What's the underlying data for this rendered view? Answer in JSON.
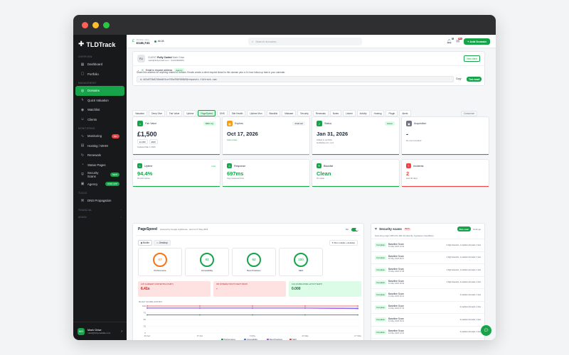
{
  "colors": {
    "accent": "#16a34a",
    "sidebar": "#18191b"
  },
  "sidebar": {
    "brand": "TLDTrack",
    "sections": {
      "overview": "OVERVIEW",
      "management": "MANAGEMENT",
      "monitoring": "MONITORING",
      "tools": "TOOLS",
      "financial": "FINANCIAL",
      "admin": "ADMIN"
    },
    "items": [
      {
        "label": "Dashboard",
        "icon": "grid-icon"
      },
      {
        "label": "Portfolio",
        "icon": "folder-icon"
      },
      {
        "label": "Domains",
        "icon": "globe-icon"
      },
      {
        "label": "Quick Valuation",
        "icon": "bolt-icon"
      },
      {
        "label": "Watchlist",
        "icon": "eye-icon"
      },
      {
        "label": "Clients",
        "icon": "users-icon"
      },
      {
        "label": "Monitoring",
        "icon": "pulse-icon",
        "badge": "99+"
      },
      {
        "label": "Hosting / WHM",
        "icon": "server-icon"
      },
      {
        "label": "Renewals",
        "icon": "refresh-icon"
      },
      {
        "label": "Status Pages",
        "icon": "signal-icon"
      },
      {
        "label": "Security Scans",
        "icon": "shield-icon",
        "badge": "NEW"
      },
      {
        "label": "Agency",
        "icon": "briefcase-icon",
        "badge": "OWN APP"
      },
      {
        "label": "DNS Propagation",
        "icon": "network-icon"
      }
    ],
    "user": {
      "initials": "MG",
      "name": "Mark Grise",
      "email": "mark@fullyundable.com"
    }
  },
  "topbar": {
    "portfolio_label": "Portfolio value",
    "portfolio_value": "£146,741",
    "count_value": "46.08",
    "search_placeholder": "Search domains...",
    "add_button": "+ Add Domain",
    "notif_count": "4",
    "alert_count": "99+"
  },
  "client": {
    "initials": "FU",
    "label": "CLIENT",
    "name": "Fully Coded",
    "owner": "Mark Grise",
    "email": "mark@fullycoded.com",
    "phone": "01234848484",
    "view_client": "View client"
  },
  "email": {
    "title": "Email to request address",
    "tag": "Agency",
    "desc": "Share this address for anything related to domain. Emails create a client request linked to this domain plus a 24-hour follow-up task in your calendar.",
    "address": "d-443c873b6236eb6f4cef55a350f665b9@requests.tldtrack.com",
    "copy": "Copy",
    "test": "Test email"
  },
  "tabs": [
    "Valuation",
    "Deep Dive",
    "Fair Value",
    "Uptime",
    "PageSpeed",
    "DNS",
    "Site Health",
    "Uptime Mon",
    "Blacklist",
    "Malware",
    "Security",
    "Renewals",
    "Notes",
    "Linked",
    "Activity",
    "Hosting",
    "Plugin",
    "Alerts"
  ],
  "tabs_right": "Customize",
  "kpis": [
    {
      "title": "Fair Value",
      "tag": "BRK 1Q",
      "value": "£1,500",
      "sub": "Updated Mar 1 2026",
      "chip1": "£1,000",
      "chip2": "£640",
      "color": "#16a34a",
      "icon": "tag-icon"
    },
    {
      "title": "Expires",
      "tag": "233d left",
      "value": "Oct 17, 2026",
      "sub": "Auto renew",
      "color": "#f59e0b",
      "icon": "calendar-icon"
    },
    {
      "title": "Status",
      "tag": "Active",
      "value": "Jan 31, 2026",
      "sub": "Added to portfolio",
      "sub2": "GoDaddy.com, LLC",
      "color": "#16a34a",
      "icon": "check-icon"
    },
    {
      "title": "Acquisition",
      "tag": "",
      "value": "-",
      "sub": "No cost recorded",
      "color": "#6b7280",
      "icon": "lock-icon"
    }
  ],
  "kpis2": [
    {
      "title": "Uptime",
      "tag": "Live",
      "value": "94.4%",
      "sub": "Re-tick uptime",
      "color": "#16a34a"
    },
    {
      "title": "Response",
      "tag": "",
      "value": "697ms",
      "sub": "Avg measured time",
      "color": "#16a34a"
    },
    {
      "title": "Blacklist",
      "tag": "",
      "value": "Clean",
      "sub": "On clean",
      "color": "#16a34a"
    },
    {
      "title": "Incidents",
      "tag": "",
      "value": "2",
      "sub": "Last 90 days",
      "color": "#ef4444"
    }
  ],
  "pagespeed": {
    "title": "PageSpeed",
    "sub": "powered by Google Lighthouse · last run 17 May 2026",
    "toggle_label": "On",
    "mobile": "Mobile",
    "desktop": "Desktop",
    "run": "Run mobile + desktop",
    "scores": [
      {
        "label": "Performance",
        "value": "67",
        "color": "#f97316"
      },
      {
        "label": "Accessibility",
        "value": "93",
        "color": "#16a34a"
      },
      {
        "label": "Best Practices",
        "value": "92",
        "color": "#16a34a"
      },
      {
        "label": "SEO",
        "value": "100",
        "color": "#16a34a"
      }
    ],
    "metrics": [
      {
        "label": "LCP (LARGEST CONTENTFUL PAINT)",
        "value": "6.41s",
        "color": "#fee2e2",
        "text": "#b91c1c"
      },
      {
        "label": "INP (INTERACTION TO NEXT PAINT)",
        "value": "-",
        "color": "#fee2e2",
        "text": "#b91c1c"
      },
      {
        "label": "CLS (CUMULATIVE LAYOUT SHIFT)",
        "value": "0.000",
        "color": "#dcfce7",
        "text": "#166534"
      }
    ],
    "history_label": "90-DAY SCORE HISTORY"
  },
  "chart_data": {
    "type": "line",
    "x": [
      "20 Apr",
      "27 Apr",
      "4 May",
      "11 May",
      "17 May"
    ],
    "ylim": [
      0,
      100
    ],
    "yticks": [
      0,
      25,
      50,
      75,
      100
    ],
    "series": [
      {
        "name": "Performance",
        "color": "#16a34a",
        "values": [
          67,
          67,
          67,
          67,
          67
        ]
      },
      {
        "name": "Accessibility",
        "color": "#3b82f6",
        "values": [
          93,
          93,
          93,
          93,
          92
        ]
      },
      {
        "name": "Best Practices",
        "color": "#a855f7",
        "values": [
          92,
          92,
          92,
          92,
          90
        ]
      },
      {
        "name": "SEO",
        "color": "#ef4444",
        "values": [
          100,
          100,
          100,
          100,
          100
        ]
      }
    ]
  },
  "security": {
    "title": "Security scans",
    "beta": "BETA",
    "run": "Run scan",
    "settings": "Settings",
    "scanning": "Scanning origin 185.241.184.43 (directly, bypasses cloudflare)",
    "scans": [
      {
        "status": "Complete",
        "name": "Baseline Scan",
        "date": "16 May 2026 13:33",
        "result": "2 high Acunetix, 1 medium Acunetix, 2 low"
      },
      {
        "status": "Complete",
        "name": "Baseline Scan",
        "date": "16 May 2026 08:27",
        "result": "1 high Acunetix, 1 medium Acunetix, 1 low"
      },
      {
        "status": "Complete",
        "name": "Baseline Scan",
        "date": "15 May 2026 07:08",
        "result": "1 high Acunetix, 1 medium Acunetix, 1 low"
      },
      {
        "status": "Complete",
        "name": "Baseline Scan",
        "date": "14 May 2026 18:09",
        "result": "1 high Acunetix, 2 medium Acunetix, 2 low"
      },
      {
        "status": "Complete",
        "name": "Baseline Scan",
        "date": "14 May 2026 09:12",
        "result": "4 medium Acunetix, 1 low"
      },
      {
        "status": "Complete",
        "name": "Baseline Scan",
        "date": "14 May 2026 07:43",
        "result": "4 medium Acunetix, 2 low"
      },
      {
        "status": "Complete",
        "name": "Baseline Scan",
        "date": "13 May 2026 18:41",
        "result": "4 medium Acunetix, 2 low"
      },
      {
        "status": "Complete",
        "name": "Baseline Scan",
        "date": "13 May 2026 14:31",
        "result": "4 medium Acunetix, 2 low"
      },
      {
        "status": "Complete",
        "name": "Baseline Scan",
        "date": "12 May 2026 18:40",
        "result": "4 medium Acunetix, 2 low"
      },
      {
        "status": "Complete",
        "name": "Baseline Scan",
        "date": "12 May 2026 11:12",
        "result": "4 medium Acunetix, 2 low"
      }
    ]
  }
}
